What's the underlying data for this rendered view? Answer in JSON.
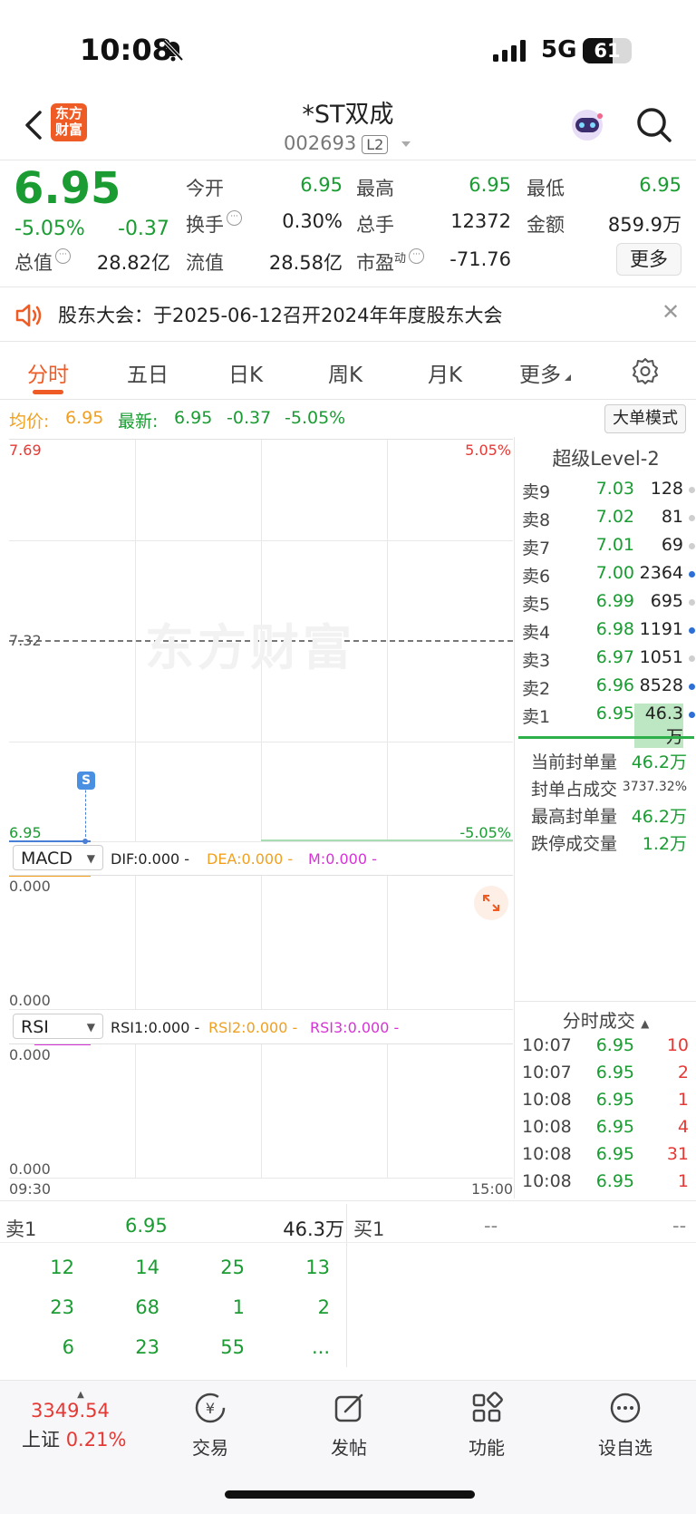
{
  "status_bar": {
    "time": "10:08",
    "network": "5G",
    "battery": "61",
    "battery_level": 0.61
  },
  "header": {
    "stock_name": "*ST双成",
    "stock_code": "002693",
    "level_badge": "L2",
    "logo_text": "东方\n财富"
  },
  "quote": {
    "price": "6.95",
    "change_pct": "-5.05%",
    "change": "-0.37",
    "fields": {
      "open_label": "今开",
      "open": "6.95",
      "high_label": "最高",
      "high": "6.95",
      "low_label": "最低",
      "low": "6.95",
      "turnover_label": "换手",
      "turnover": "0.30%",
      "volume_label": "总手",
      "volume": "12372",
      "amount_label": "金额",
      "amount": "859.9万",
      "mktcap_label": "总值",
      "mktcap": "28.82亿",
      "float_label": "流值",
      "float": "28.58亿",
      "pe_label": "市盈",
      "pe_sup": "动",
      "pe": "-71.76"
    },
    "more_label": "更多"
  },
  "announcement": {
    "text": "股东大会：于2025-06-12召开2024年年度股东大会"
  },
  "tabs": [
    "分时",
    "五日",
    "日K",
    "周K",
    "月K",
    "更多"
  ],
  "price_line": {
    "avg_label": "均价:",
    "avg": "6.95",
    "latest_label": "最新:",
    "latest": "6.95",
    "change": "-0.37",
    "change_pct": "-5.05%",
    "big_order_label": "大单模式"
  },
  "intraday_chart": {
    "y_top": "7.69",
    "y_mid": "7.32",
    "y_bottom": "6.95",
    "pct_top": "5.05%",
    "pct_bottom": "-5.05%",
    "watermark": "东方财富",
    "marker": "S",
    "time_start": "09:30",
    "time_end": "15:00"
  },
  "macd": {
    "name": "MACD",
    "dif": "DIF:0.000 -",
    "dea": "DEA:0.000 -",
    "m": "M:0.000 -",
    "top": "0.000",
    "bottom": "0.000"
  },
  "rsi": {
    "name": "RSI",
    "rsi1": "RSI1:0.000 -",
    "rsi2": "RSI2:0.000 -",
    "rsi3": "RSI3:0.000 -",
    "top": "0.000",
    "bottom": "0.000"
  },
  "level2": {
    "title": "超级Level-2",
    "asks": [
      {
        "name": "卖9",
        "price": "7.03",
        "vol": "128",
        "dot": "gray"
      },
      {
        "name": "卖8",
        "price": "7.02",
        "vol": "81",
        "dot": "gray"
      },
      {
        "name": "卖7",
        "price": "7.01",
        "vol": "69",
        "dot": "gray"
      },
      {
        "name": "卖6",
        "price": "7.00",
        "vol": "2364",
        "dot": "blue"
      },
      {
        "name": "卖5",
        "price": "6.99",
        "vol": "695",
        "dot": "gray"
      },
      {
        "name": "卖4",
        "price": "6.98",
        "vol": "1191",
        "dot": "blue"
      },
      {
        "name": "卖3",
        "price": "6.97",
        "vol": "1051",
        "dot": "gray"
      },
      {
        "name": "卖2",
        "price": "6.96",
        "vol": "8528",
        "dot": "blue"
      },
      {
        "name": "卖1",
        "price": "6.95",
        "vol": "46.3万",
        "dot": "blue"
      }
    ],
    "seal": [
      {
        "label": "当前封单量",
        "value": "46.2万"
      },
      {
        "label": "封单占成交",
        "value": "3737.32%"
      },
      {
        "label": "最高封单量",
        "value": "46.2万"
      },
      {
        "label": "跌停成交量",
        "value": "1.2万"
      }
    ],
    "trades_title": "分时成交",
    "trades": [
      {
        "time": "10:07",
        "price": "6.95",
        "vol": "10"
      },
      {
        "time": "10:07",
        "price": "6.95",
        "vol": "2"
      },
      {
        "time": "10:08",
        "price": "6.95",
        "vol": "1"
      },
      {
        "time": "10:08",
        "price": "6.95",
        "vol": "4"
      },
      {
        "time": "10:08",
        "price": "6.95",
        "vol": "31"
      },
      {
        "time": "10:08",
        "price": "6.95",
        "vol": "1"
      }
    ]
  },
  "book": {
    "sell1_label": "卖1",
    "sell1_price": "6.95",
    "sell1_vol": "46.3万",
    "buy1_label": "买1",
    "buy1_price": "--",
    "buy1_vol": "--",
    "queue": [
      "12",
      "14",
      "25",
      "13",
      "23",
      "68",
      "1",
      "2",
      "6",
      "23",
      "55",
      "..."
    ]
  },
  "bottom_nav": {
    "index_value": "3349.54",
    "index_name": "上证",
    "index_pct": "0.21%",
    "items": [
      "交易",
      "发帖",
      "功能",
      "设自选"
    ]
  }
}
